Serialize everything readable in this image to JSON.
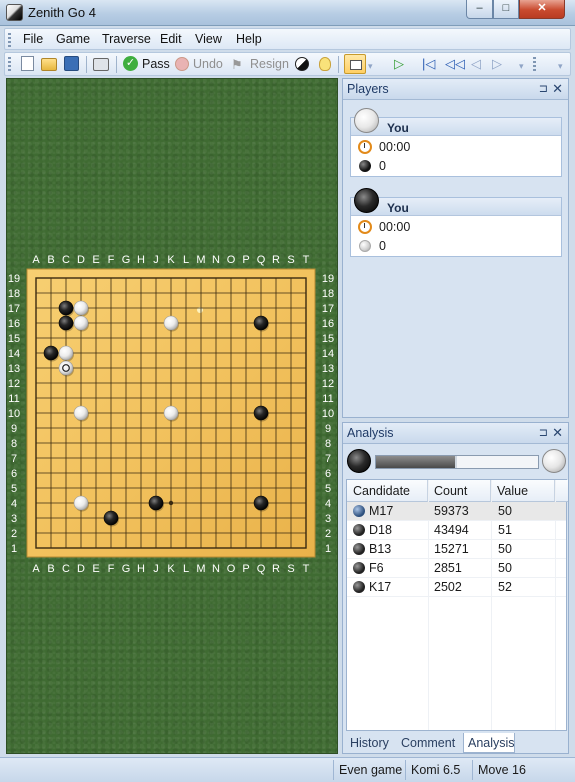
{
  "window": {
    "title": "Zenith Go 4",
    "min_glyph": "–",
    "max_glyph": "□",
    "close_glyph": "✕"
  },
  "menu": [
    "File",
    "Game",
    "Traverse",
    "Edit",
    "View",
    "Help"
  ],
  "toolbar": {
    "pass_label": "Pass",
    "undo_label": "Undo",
    "resign_label": "Resign",
    "icons": [
      "new-doc-icon",
      "open-folder-icon",
      "save-icon",
      "print-icon",
      "pass-check-icon",
      "undo-icon",
      "resign-flag-icon",
      "half-stone-icon",
      "hint-bulb-icon",
      "active-mode-icon",
      "play-icon",
      "first-move-icon",
      "prev-ten-icon",
      "prev-icon",
      "next-icon"
    ],
    "nav_glyphs": {
      "play": "▷",
      "first": "|◁",
      "back_fast": "◁◁",
      "prev": "◁",
      "next": "▷"
    }
  },
  "board": {
    "columns": [
      "A",
      "B",
      "C",
      "D",
      "E",
      "F",
      "G",
      "H",
      "J",
      "K",
      "L",
      "M",
      "N",
      "O",
      "P",
      "Q",
      "R",
      "S",
      "T"
    ],
    "rows": [
      "19",
      "18",
      "17",
      "16",
      "15",
      "14",
      "13",
      "12",
      "11",
      "10",
      "9",
      "8",
      "7",
      "6",
      "5",
      "4",
      "3",
      "2",
      "1"
    ],
    "stones": [
      {
        "color": "black",
        "col": "C",
        "row": 17
      },
      {
        "color": "white",
        "col": "D",
        "row": 17
      },
      {
        "color": "black",
        "col": "C",
        "row": 16
      },
      {
        "color": "white",
        "col": "D",
        "row": 16
      },
      {
        "color": "white",
        "col": "K",
        "row": 16
      },
      {
        "color": "black",
        "col": "Q",
        "row": 16
      },
      {
        "color": "black",
        "col": "B",
        "row": 14
      },
      {
        "color": "white",
        "col": "C",
        "row": 14
      },
      {
        "color": "white",
        "col": "C",
        "row": 13,
        "last_move": true
      },
      {
        "color": "white",
        "col": "D",
        "row": 10
      },
      {
        "color": "white",
        "col": "K",
        "row": 10
      },
      {
        "color": "black",
        "col": "Q",
        "row": 10
      },
      {
        "color": "white",
        "col": "D",
        "row": 4
      },
      {
        "color": "black",
        "col": "J",
        "row": 4
      },
      {
        "color": "black",
        "col": "Q",
        "row": 4
      },
      {
        "color": "black",
        "col": "F",
        "row": 3
      }
    ],
    "star_points": [
      [
        "D",
        16
      ],
      [
        "K",
        16
      ],
      [
        "Q",
        16
      ],
      [
        "D",
        10
      ],
      [
        "K",
        10
      ],
      [
        "Q",
        10
      ],
      [
        "D",
        4
      ],
      [
        "K",
        4
      ],
      [
        "Q",
        4
      ]
    ],
    "colors": {
      "wood": "#f2c25e",
      "felt": "#3f6b32",
      "line": "#3a2a10"
    }
  },
  "players": {
    "title": "Players",
    "pin_glyph": "⊐",
    "close_glyph": "✕",
    "list": [
      {
        "stone": "white",
        "name": "You",
        "time": "00:00",
        "captures": "0"
      },
      {
        "stone": "black",
        "name": "You",
        "time": "00:00",
        "captures": "0"
      }
    ]
  },
  "analysis": {
    "title": "Analysis",
    "pin_glyph": "⊐",
    "close_glyph": "✕",
    "black_share": 0.5,
    "columns": [
      "Candidate",
      "Count",
      "Value"
    ],
    "rows": [
      {
        "move": "M17",
        "count": "59373",
        "value": "50"
      },
      {
        "move": "D18",
        "count": "43494",
        "value": "51"
      },
      {
        "move": "B13",
        "count": "15271",
        "value": "50"
      },
      {
        "move": "F6",
        "count": "2851",
        "value": "50"
      },
      {
        "move": "K17",
        "count": "2502",
        "value": "52"
      }
    ],
    "tabs": [
      "History",
      "Comment",
      "Analysis"
    ],
    "active_tab": "Analysis"
  },
  "status": {
    "game_type": "Even game",
    "komi": "Komi 6.5",
    "move": "Move 16"
  }
}
